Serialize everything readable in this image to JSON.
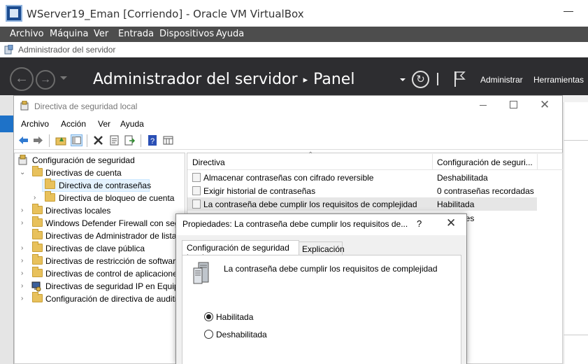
{
  "vbox": {
    "title": "WServer19_Eman [Corriendo] - Oracle VM VirtualBox",
    "menu": [
      "Archivo",
      "Máquina",
      "Ver",
      "Entrada",
      "Dispositivos",
      "Ayuda"
    ]
  },
  "server_manager": {
    "window_title": "Administrador del servidor",
    "heading": "Administrador del servidor",
    "heading_page": "Panel",
    "manage_label": "Administrar",
    "tools_label": "Herramientas"
  },
  "lsp": {
    "window_title": "Directiva de seguridad local",
    "menu": [
      "Archivo",
      "Acción",
      "Ver",
      "Ayuda"
    ],
    "tree": [
      {
        "label": "Configuración de seguridad"
      },
      {
        "label": "Directivas de cuenta"
      },
      {
        "label": "Directiva de contraseñas"
      },
      {
        "label": "Directiva de bloqueo de cuenta"
      },
      {
        "label": "Directivas locales"
      },
      {
        "label": "Windows Defender Firewall con seg"
      },
      {
        "label": "Directivas de Administrador de lista"
      },
      {
        "label": "Directivas de clave pública"
      },
      {
        "label": "Directivas de restricción de software"
      },
      {
        "label": "Directivas de control de aplicacione"
      },
      {
        "label": "Directivas de seguridad IP en Equipo"
      },
      {
        "label": "Configuración de directiva de auditi"
      }
    ],
    "columns": {
      "policy": "Directiva",
      "setting": "Configuración de seguri..."
    },
    "rows": [
      {
        "name": "Almacenar contraseñas con cifrado reversible",
        "value": "Deshabilitada"
      },
      {
        "name": "Exigir historial de contraseñas",
        "value": "0 contraseñas recordadas"
      },
      {
        "name": "La contraseña debe cumplir los requisitos de complejidad",
        "value": "Habilitada"
      }
    ],
    "hidden_value_fragment": "eres"
  },
  "dialog": {
    "title": "Propiedades: La contraseña debe cumplir los requisitos de...",
    "help": "?",
    "tabs": [
      "Configuración de seguridad local",
      "Explicación"
    ],
    "description": "La contraseña debe cumplir los requisitos de complejidad",
    "options": [
      {
        "label": "Habilitada",
        "selected": true
      },
      {
        "label": "Deshabilitada",
        "selected": false
      }
    ]
  }
}
